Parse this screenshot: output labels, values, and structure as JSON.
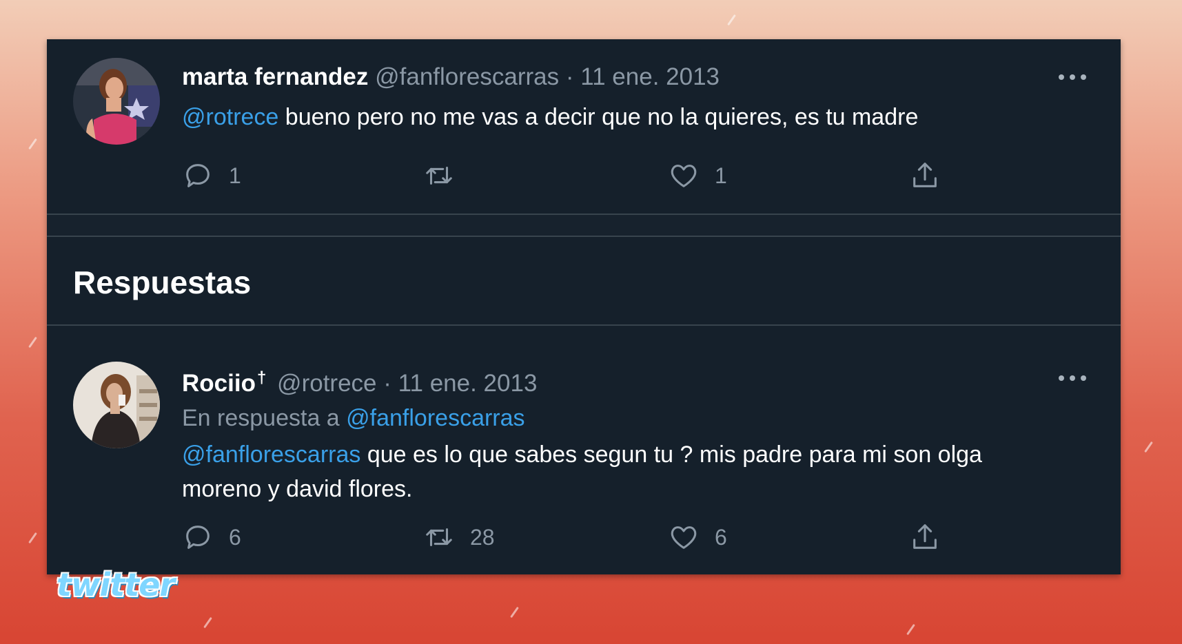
{
  "logo": "twitter",
  "colors": {
    "panel_bg": "#15202b",
    "mention": "#3aa0e8",
    "muted": "#8b98a5",
    "text": "#ffffff"
  },
  "main_tweet": {
    "display_name": "marta fernandez",
    "handle": "@fanflorescarras",
    "separator": "·",
    "date": "11 ene. 2013",
    "mention": "@rotrece",
    "text": "bueno pero no me vas a decir que no la quieres, es tu madre",
    "actions": {
      "reply_icon": "reply-icon",
      "reply_count": "1",
      "retweet_icon": "retweet-icon",
      "retweet_count": "",
      "like_icon": "heart-icon",
      "like_count": "1",
      "share_icon": "share-icon"
    }
  },
  "replies_section": {
    "title": "Respuestas"
  },
  "reply_tweet": {
    "display_name": "Rociio",
    "name_suffix": "†",
    "handle": "@rotrece",
    "separator": "·",
    "date": "11 ene. 2013",
    "replying_prefix": "En respuesta a",
    "replying_to": "@fanflorescarras",
    "mention": "@fanflorescarras",
    "text": "que es lo que sabes segun tu ? mis padre para mi son olga moreno y david flores.",
    "actions": {
      "reply_icon": "reply-icon",
      "reply_count": "6",
      "retweet_icon": "retweet-icon",
      "retweet_count": "28",
      "like_icon": "heart-icon",
      "like_count": "6",
      "share_icon": "share-icon"
    }
  }
}
